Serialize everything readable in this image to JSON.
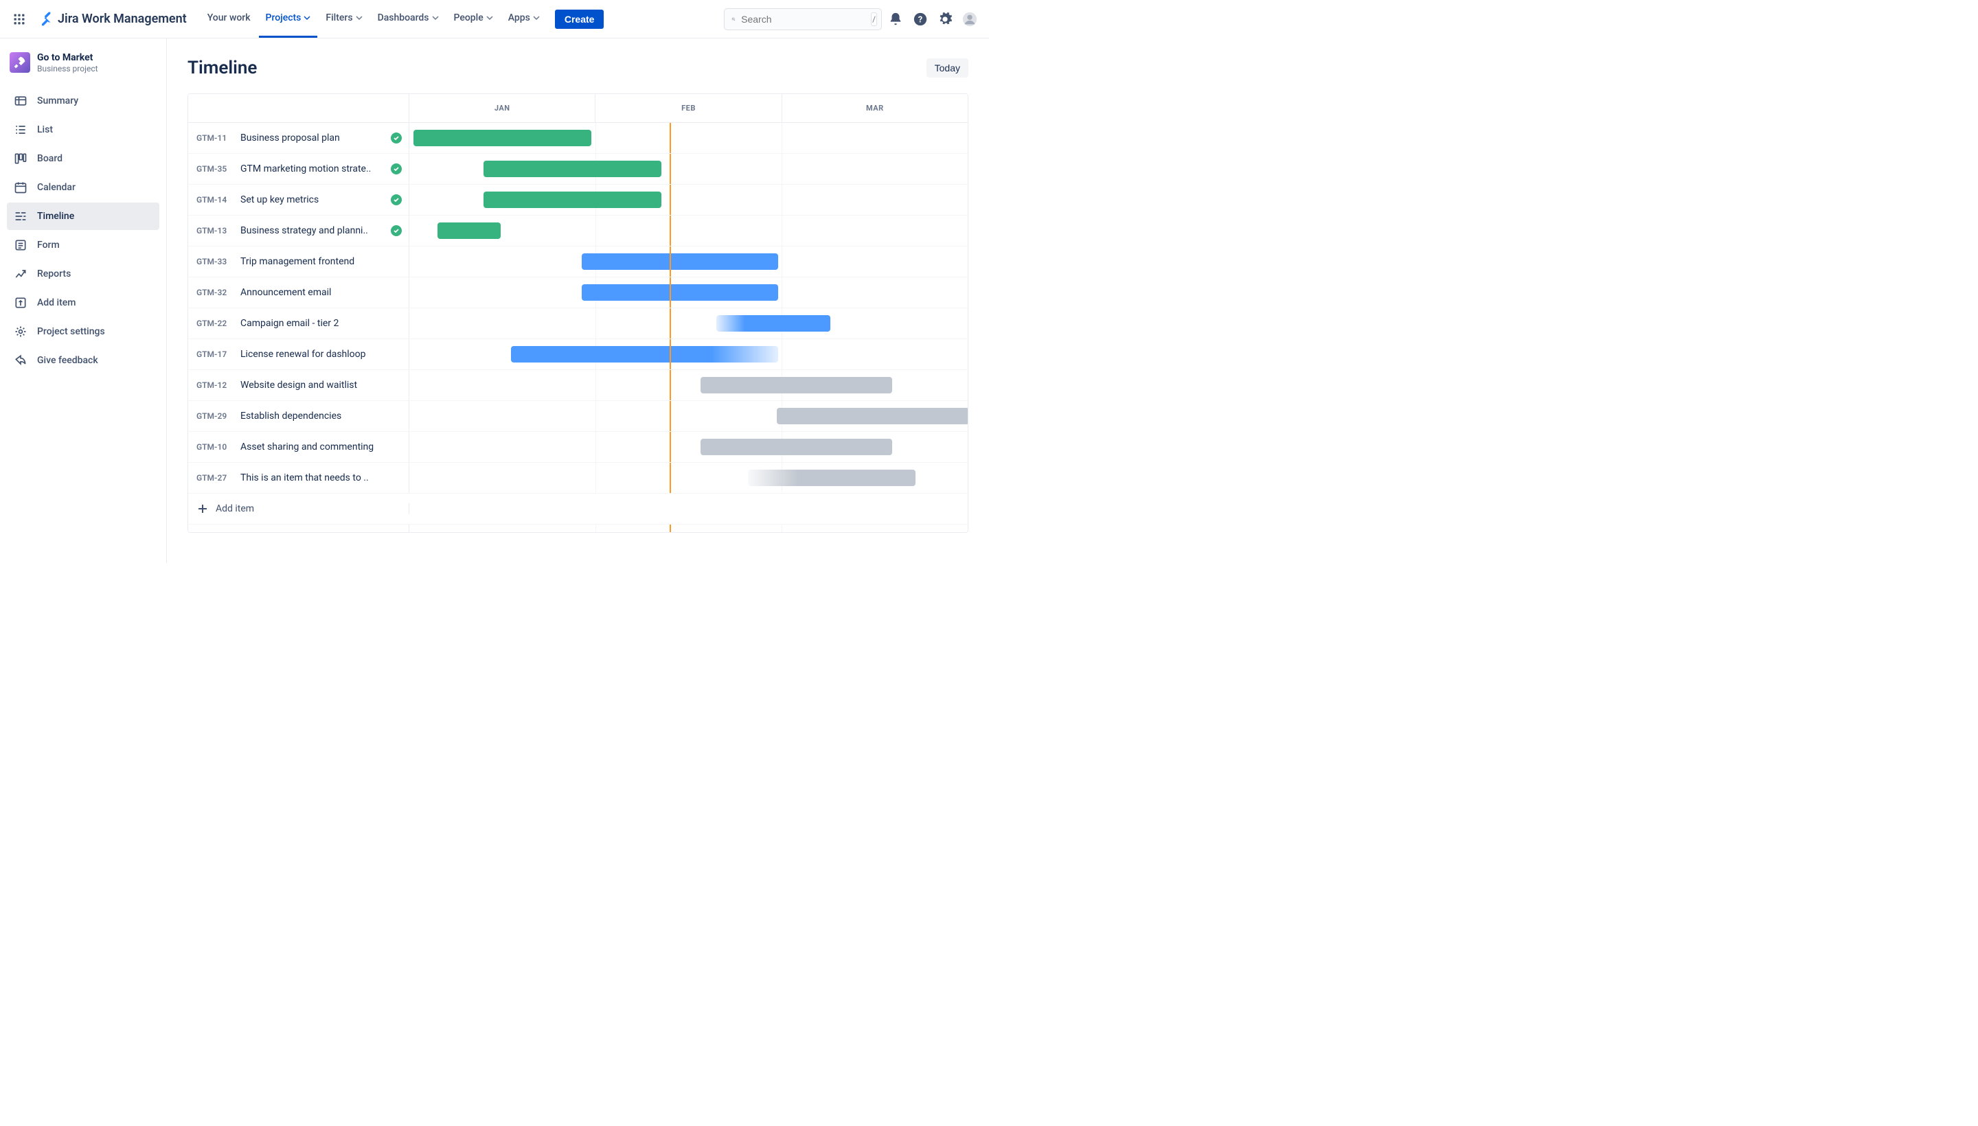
{
  "app_name": "Jira Work Management",
  "nav": {
    "your_work": "Your work",
    "projects": "Projects",
    "filters": "Filters",
    "dashboards": "Dashboards",
    "people": "People",
    "apps": "Apps",
    "create": "Create"
  },
  "search": {
    "placeholder": "Search",
    "shortcut": "/"
  },
  "project": {
    "name": "Go to Market",
    "type": "Business project"
  },
  "sidebar": {
    "items": [
      {
        "label": "Summary"
      },
      {
        "label": "List"
      },
      {
        "label": "Board"
      },
      {
        "label": "Calendar"
      },
      {
        "label": "Timeline"
      },
      {
        "label": "Form"
      },
      {
        "label": "Reports"
      },
      {
        "label": "Add item"
      },
      {
        "label": "Project settings"
      },
      {
        "label": "Give feedback"
      }
    ]
  },
  "page": {
    "title": "Timeline",
    "today": "Today",
    "add_item": "Add item"
  },
  "months": [
    "JAN",
    "FEB",
    "MAR"
  ],
  "today_pct": 46.6,
  "tasks": [
    {
      "key": "GTM-11",
      "title": "Business proposal plan",
      "done": true,
      "bar": {
        "left": 0.7,
        "width": 31.9,
        "style": "green"
      }
    },
    {
      "key": "GTM-35",
      "title": "GTM marketing motion strate..",
      "done": true,
      "bar": {
        "left": 13.3,
        "width": 31.8,
        "style": "green"
      }
    },
    {
      "key": "GTM-14",
      "title": "Set up key metrics",
      "done": true,
      "bar": {
        "left": 13.3,
        "width": 31.8,
        "style": "green"
      }
    },
    {
      "key": "GTM-13",
      "title": "Business strategy and planni..",
      "done": true,
      "bar": {
        "left": 5.0,
        "width": 11.4,
        "style": "green"
      }
    },
    {
      "key": "GTM-33",
      "title": "Trip management frontend",
      "done": false,
      "bar": {
        "left": 30.9,
        "width": 35.1,
        "style": "blue"
      }
    },
    {
      "key": "GTM-32",
      "title": "Announcement email",
      "done": false,
      "bar": {
        "left": 30.9,
        "width": 35.1,
        "style": "blue"
      }
    },
    {
      "key": "GTM-22",
      "title": "Campaign email - tier 2",
      "done": false,
      "bar": {
        "left": 55.0,
        "width": 20.4,
        "style": "blue-fade-l"
      }
    },
    {
      "key": "GTM-17",
      "title": "License renewal for dashloop",
      "done": false,
      "bar": {
        "left": 18.2,
        "width": 47.8,
        "style": "blue-fade-r"
      }
    },
    {
      "key": "GTM-12",
      "title": "Website design and waitlist",
      "done": false,
      "bar": {
        "left": 52.1,
        "width": 34.4,
        "style": "gray"
      }
    },
    {
      "key": "GTM-29",
      "title": "Establish dependencies",
      "done": false,
      "bar": {
        "left": 65.8,
        "width": 34.4,
        "style": "gray"
      }
    },
    {
      "key": "GTM-10",
      "title": "Asset sharing and commenting",
      "done": false,
      "bar": {
        "left": 52.1,
        "width": 34.4,
        "style": "gray"
      }
    },
    {
      "key": "GTM-27",
      "title": "This is an item that needs to ..",
      "done": false,
      "bar": {
        "left": 60.6,
        "width": 30.0,
        "style": "gray-fade-l"
      }
    }
  ]
}
